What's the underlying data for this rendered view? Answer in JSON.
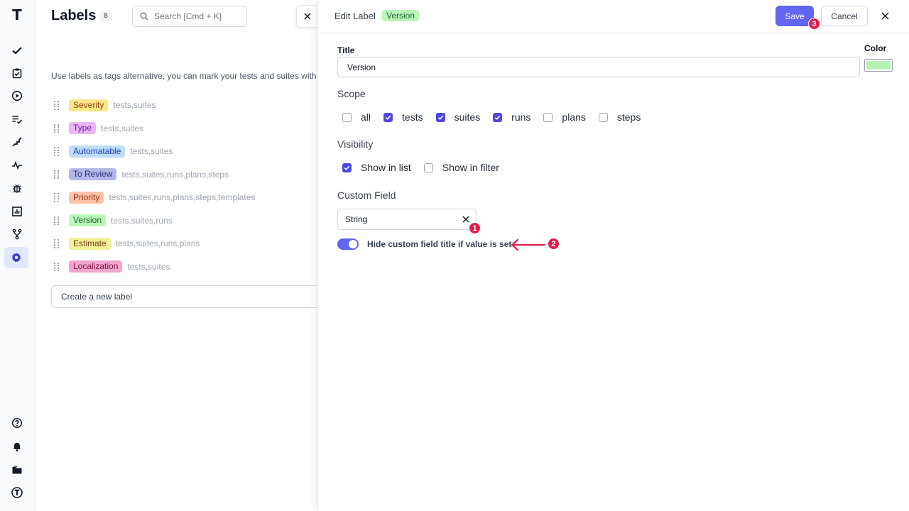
{
  "nav": {
    "logo": "T",
    "items": [
      {
        "icon": "check-icon"
      },
      {
        "icon": "clipboard-check-icon"
      },
      {
        "icon": "play-circle-icon"
      },
      {
        "icon": "list-check-icon"
      },
      {
        "icon": "stairs-icon"
      },
      {
        "icon": "pulse-icon"
      },
      {
        "icon": "bug-icon"
      },
      {
        "icon": "bar-chart-icon"
      },
      {
        "icon": "branch-icon"
      },
      {
        "icon": "gear-icon",
        "active": true
      }
    ],
    "bottom": [
      {
        "icon": "help-icon"
      },
      {
        "icon": "bell-icon"
      },
      {
        "icon": "folder-icon"
      },
      {
        "icon": "profile-logo-icon"
      }
    ]
  },
  "labels_page": {
    "title": "Labels",
    "count": "8",
    "search_placeholder": "Search [Cmd + K]",
    "description": "Use labels as tags alternative, you can mark your tests and suites with",
    "labels": [
      {
        "name": "Severity",
        "scopes": "tests,suites",
        "bg": "#fde68a",
        "fg": "#92400e"
      },
      {
        "name": "Type",
        "scopes": "tests,suites",
        "bg": "#e9b6f7",
        "fg": "#6b21a8"
      },
      {
        "name": "Automatable",
        "scopes": "tests,suites",
        "bg": "#bfdbfe",
        "fg": "#1e40af"
      },
      {
        "name": "To Review",
        "scopes": "tests,suites,runs,plans,steps",
        "bg": "#b4b8e6",
        "fg": "#312e81"
      },
      {
        "name": "Priority",
        "scopes": "tests,suites,runs,plans,steps,templates",
        "bg": "#fbc4a8",
        "fg": "#9a3412"
      },
      {
        "name": "Version",
        "scopes": "tests,suites,runs",
        "bg": "#bbf7b8",
        "fg": "#166534"
      },
      {
        "name": "Estimate",
        "scopes": "tests,suites,runs,plans",
        "bg": "#f0f29a",
        "fg": "#713f12"
      },
      {
        "name": "Localization",
        "scopes": "tests,suites",
        "bg": "#f0a6cf",
        "fg": "#831843"
      }
    ],
    "new_label_placeholder": "Create a new label"
  },
  "edit_panel": {
    "heading": "Edit Label",
    "label_tag": "Version",
    "label_tag_bg": "#bbf7b8",
    "label_tag_fg": "#166534",
    "save_label": "Save",
    "cancel_label": "Cancel",
    "title_label": "Title",
    "title_value": "Version",
    "color_label": "Color",
    "color_value": "#b7f0b4",
    "scope_label": "Scope",
    "scope_options": [
      {
        "label": "all",
        "checked": false
      },
      {
        "label": "tests",
        "checked": true
      },
      {
        "label": "suites",
        "checked": true
      },
      {
        "label": "runs",
        "checked": true
      },
      {
        "label": "plans",
        "checked": false
      },
      {
        "label": "steps",
        "checked": false
      }
    ],
    "visibility_label": "Visibility",
    "visibility_options": [
      {
        "label": "Show in list",
        "checked": true
      },
      {
        "label": "Show in filter",
        "checked": false
      }
    ],
    "custom_field_label": "Custom Field",
    "custom_field_value": "String",
    "hide_title_toggle_label": "Hide custom field title if value is set",
    "hide_title_toggle_on": true
  },
  "annotations": {
    "marker_1": "1",
    "marker_2": "2",
    "marker_3": "3",
    "accent": "#e11d48"
  }
}
